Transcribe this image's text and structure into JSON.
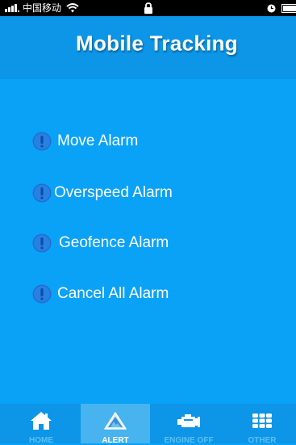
{
  "status_bar": {
    "carrier": "中国移动",
    "icons": [
      "signal-icon",
      "wifi-icon",
      "lock-icon",
      "clock-icon",
      "battery-icon"
    ]
  },
  "header": {
    "title": "Mobile Tracking"
  },
  "alarms": [
    {
      "label": "Move Alarm",
      "icon": "alert-icon"
    },
    {
      "label": "Overspeed Alarm",
      "icon": "alert-icon"
    },
    {
      "label": "Geofence Alarm",
      "icon": "alert-icon"
    },
    {
      "label": "Cancel All Alarm",
      "icon": "alert-icon"
    }
  ],
  "tabs": [
    {
      "label": "HOME",
      "icon": "home-icon",
      "active": false
    },
    {
      "label": "ALERT",
      "icon": "warning-icon",
      "active": true
    },
    {
      "label": "ENGINE OFF",
      "icon": "engine-icon",
      "active": false
    },
    {
      "label": "OTHER",
      "icon": "grid-icon",
      "active": false
    }
  ],
  "colors": {
    "background": "#0aa2f7",
    "header": "#0d95e7",
    "tab_active": "#47b3ef",
    "icon_circle": "#1e6fd0"
  }
}
